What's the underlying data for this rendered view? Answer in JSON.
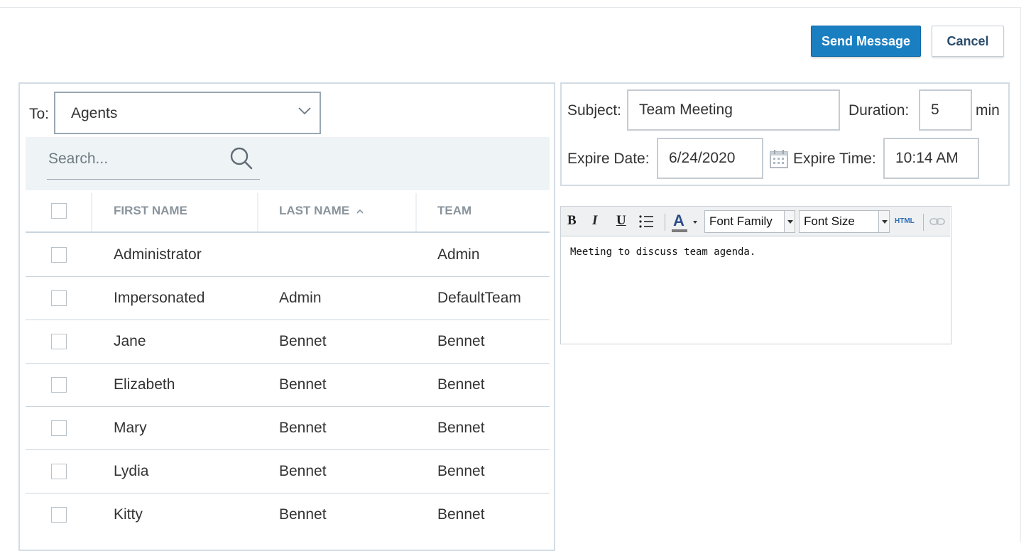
{
  "actions": {
    "send_label": "Send Message",
    "cancel_label": "Cancel"
  },
  "recipients": {
    "to_label": "To:",
    "to_value": "Agents",
    "search_placeholder": "Search...",
    "columns": {
      "first_name": "FIRST NAME",
      "last_name": "LAST NAME",
      "team": "TEAM"
    },
    "sort": {
      "column": "last_name",
      "direction": "asc"
    },
    "rows": [
      {
        "first": "Administrator",
        "last": "",
        "team": "Admin"
      },
      {
        "first": "Impersonated",
        "last": "Admin",
        "team": "DefaultTeam"
      },
      {
        "first": "Jane",
        "last": "Bennet",
        "team": "Bennet"
      },
      {
        "first": "Elizabeth",
        "last": "Bennet",
        "team": "Bennet"
      },
      {
        "first": "Mary",
        "last": "Bennet",
        "team": "Bennet"
      },
      {
        "first": "Lydia",
        "last": "Bennet",
        "team": "Bennet"
      },
      {
        "first": "Kitty",
        "last": "Bennet",
        "team": "Bennet"
      }
    ]
  },
  "message": {
    "subject_label": "Subject:",
    "subject_value": "Team Meeting",
    "duration_label": "Duration:",
    "duration_value": "5",
    "duration_unit": "min",
    "expire_date_label": "Expire Date:",
    "expire_date_value": "6/24/2020",
    "expire_time_label": "Expire Time:",
    "expire_time_value": "10:14 AM"
  },
  "editor": {
    "toolbar": {
      "bold": "B",
      "italic": "I",
      "underline": "U",
      "font_color": "A",
      "font_family": "Font Family",
      "font_size": "Font Size",
      "html": "HTML"
    },
    "content": "Meeting to discuss team agenda."
  },
  "colors": {
    "primary": "#1a7fc1",
    "border": "#d3dce3",
    "header_text": "#8a949c",
    "search_band": "#eef3f6"
  }
}
